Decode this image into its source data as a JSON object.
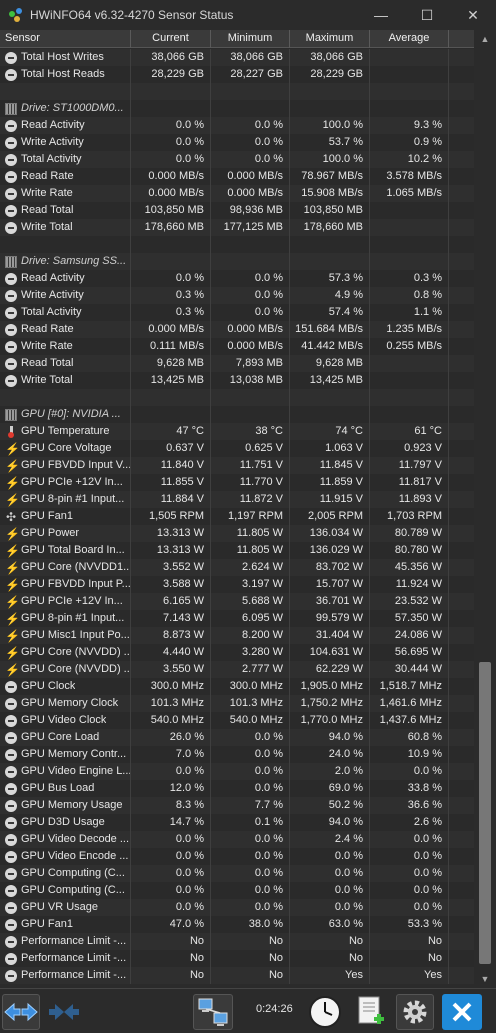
{
  "window": {
    "title": "HWiNFO64 v6.32-4270 Sensor Status",
    "minimize_glyph": "—",
    "maximize_glyph": "☐",
    "close_glyph": "✕"
  },
  "table": {
    "columns": [
      "Sensor",
      "Current",
      "Minimum",
      "Maximum",
      "Average"
    ],
    "rows": [
      {
        "icon": "circle",
        "name": "Total Host Writes",
        "current": "38,066 GB",
        "minimum": "38,066 GB",
        "maximum": "38,066 GB",
        "average": ""
      },
      {
        "icon": "circle",
        "name": "Total Host Reads",
        "current": "28,229 GB",
        "minimum": "28,227 GB",
        "maximum": "28,229 GB",
        "average": ""
      },
      {
        "blank": true
      },
      {
        "icon": "chip",
        "group": true,
        "name": "Drive: ST1000DM0..."
      },
      {
        "icon": "circle",
        "name": "Read Activity",
        "current": "0.0 %",
        "minimum": "0.0 %",
        "maximum": "100.0 %",
        "average": "9.3 %"
      },
      {
        "icon": "circle",
        "name": "Write Activity",
        "current": "0.0 %",
        "minimum": "0.0 %",
        "maximum": "53.7 %",
        "average": "0.9 %"
      },
      {
        "icon": "circle",
        "name": "Total Activity",
        "current": "0.0 %",
        "minimum": "0.0 %",
        "maximum": "100.0 %",
        "average": "10.2 %"
      },
      {
        "icon": "circle",
        "name": "Read Rate",
        "current": "0.000 MB/s",
        "minimum": "0.000 MB/s",
        "maximum": "78.967 MB/s",
        "average": "3.578 MB/s"
      },
      {
        "icon": "circle",
        "name": "Write Rate",
        "current": "0.000 MB/s",
        "minimum": "0.000 MB/s",
        "maximum": "15.908 MB/s",
        "average": "1.065 MB/s"
      },
      {
        "icon": "circle",
        "name": "Read Total",
        "current": "103,850 MB",
        "minimum": "98,936 MB",
        "maximum": "103,850 MB",
        "average": ""
      },
      {
        "icon": "circle",
        "name": "Write Total",
        "current": "178,660 MB",
        "minimum": "177,125 MB",
        "maximum": "178,660 MB",
        "average": ""
      },
      {
        "blank": true
      },
      {
        "icon": "chip",
        "group": true,
        "name": "Drive: Samsung SS..."
      },
      {
        "icon": "circle",
        "name": "Read Activity",
        "current": "0.0 %",
        "minimum": "0.0 %",
        "maximum": "57.3 %",
        "average": "0.3 %"
      },
      {
        "icon": "circle",
        "name": "Write Activity",
        "current": "0.3 %",
        "minimum": "0.0 %",
        "maximum": "4.9 %",
        "average": "0.8 %"
      },
      {
        "icon": "circle",
        "name": "Total Activity",
        "current": "0.3 %",
        "minimum": "0.0 %",
        "maximum": "57.4 %",
        "average": "1.1 %"
      },
      {
        "icon": "circle",
        "name": "Read Rate",
        "current": "0.000 MB/s",
        "minimum": "0.000 MB/s",
        "maximum": "151.684 MB/s",
        "average": "1.235 MB/s"
      },
      {
        "icon": "circle",
        "name": "Write Rate",
        "current": "0.111 MB/s",
        "minimum": "0.000 MB/s",
        "maximum": "41.442 MB/s",
        "average": "0.255 MB/s"
      },
      {
        "icon": "circle",
        "name": "Read Total",
        "current": "9,628 MB",
        "minimum": "7,893 MB",
        "maximum": "9,628 MB",
        "average": ""
      },
      {
        "icon": "circle",
        "name": "Write Total",
        "current": "13,425 MB",
        "minimum": "13,038 MB",
        "maximum": "13,425 MB",
        "average": ""
      },
      {
        "blank": true
      },
      {
        "icon": "chip",
        "group": true,
        "name": "GPU [#0]: NVIDIA ..."
      },
      {
        "icon": "therm",
        "name": "GPU Temperature",
        "current": "47 °C",
        "minimum": "38 °C",
        "maximum": "74 °C",
        "average": "61 °C"
      },
      {
        "icon": "bolt",
        "name": "GPU Core Voltage",
        "current": "0.637 V",
        "minimum": "0.625 V",
        "maximum": "1.063 V",
        "average": "0.923 V"
      },
      {
        "icon": "bolt",
        "name": "GPU FBVDD Input V...",
        "current": "11.840 V",
        "minimum": "11.751 V",
        "maximum": "11.845 V",
        "average": "11.797 V"
      },
      {
        "icon": "bolt",
        "name": "GPU PCIe +12V In...",
        "current": "11.855 V",
        "minimum": "11.770 V",
        "maximum": "11.859 V",
        "average": "11.817 V"
      },
      {
        "icon": "bolt",
        "name": "GPU 8-pin #1 Input...",
        "current": "11.884 V",
        "minimum": "11.872 V",
        "maximum": "11.915 V",
        "average": "11.893 V"
      },
      {
        "icon": "fan",
        "name": "GPU Fan1",
        "current": "1,505 RPM",
        "minimum": "1,197 RPM",
        "maximum": "2,005 RPM",
        "average": "1,703 RPM"
      },
      {
        "icon": "bolt",
        "name": "GPU Power",
        "current": "13.313 W",
        "minimum": "11.805 W",
        "maximum": "136.034 W",
        "average": "80.789 W"
      },
      {
        "icon": "bolt",
        "name": "GPU Total Board In...",
        "current": "13.313 W",
        "minimum": "11.805 W",
        "maximum": "136.029 W",
        "average": "80.780 W"
      },
      {
        "icon": "bolt",
        "name": "GPU Core (NVVDD1...",
        "current": "3.552 W",
        "minimum": "2.624 W",
        "maximum": "83.702 W",
        "average": "45.356 W"
      },
      {
        "icon": "bolt",
        "name": "GPU FBVDD Input P...",
        "current": "3.588 W",
        "minimum": "3.197 W",
        "maximum": "15.707 W",
        "average": "11.924 W"
      },
      {
        "icon": "bolt",
        "name": "GPU PCIe +12V In...",
        "current": "6.165 W",
        "minimum": "5.688 W",
        "maximum": "36.701 W",
        "average": "23.532 W"
      },
      {
        "icon": "bolt",
        "name": "GPU 8-pin #1 Input...",
        "current": "7.143 W",
        "minimum": "6.095 W",
        "maximum": "99.579 W",
        "average": "57.350 W"
      },
      {
        "icon": "bolt",
        "name": "GPU Misc1 Input Po...",
        "current": "8.873 W",
        "minimum": "8.200 W",
        "maximum": "31.404 W",
        "average": "24.086 W"
      },
      {
        "icon": "bolt",
        "name": "GPU Core (NVVDD) ...",
        "current": "4.440 W",
        "minimum": "3.280 W",
        "maximum": "104.631 W",
        "average": "56.695 W"
      },
      {
        "icon": "bolt",
        "name": "GPU Core (NVVDD) ...",
        "current": "3.550 W",
        "minimum": "2.777 W",
        "maximum": "62.229 W",
        "average": "30.444 W"
      },
      {
        "icon": "circle",
        "name": "GPU Clock",
        "current": "300.0 MHz",
        "minimum": "300.0 MHz",
        "maximum": "1,905.0 MHz",
        "average": "1,518.7 MHz"
      },
      {
        "icon": "circle",
        "name": "GPU Memory Clock",
        "current": "101.3 MHz",
        "minimum": "101.3 MHz",
        "maximum": "1,750.2 MHz",
        "average": "1,461.6 MHz"
      },
      {
        "icon": "circle",
        "name": "GPU Video Clock",
        "current": "540.0 MHz",
        "minimum": "540.0 MHz",
        "maximum": "1,770.0 MHz",
        "average": "1,437.6 MHz"
      },
      {
        "icon": "circle",
        "name": "GPU Core Load",
        "current": "26.0 %",
        "minimum": "0.0 %",
        "maximum": "94.0 %",
        "average": "60.8 %"
      },
      {
        "icon": "circle",
        "name": "GPU Memory Contr...",
        "current": "7.0 %",
        "minimum": "0.0 %",
        "maximum": "24.0 %",
        "average": "10.9 %"
      },
      {
        "icon": "circle",
        "name": "GPU Video Engine L...",
        "current": "0.0 %",
        "minimum": "0.0 %",
        "maximum": "2.0 %",
        "average": "0.0 %"
      },
      {
        "icon": "circle",
        "name": "GPU Bus Load",
        "current": "12.0 %",
        "minimum": "0.0 %",
        "maximum": "69.0 %",
        "average": "33.8 %"
      },
      {
        "icon": "circle",
        "name": "GPU Memory Usage",
        "current": "8.3 %",
        "minimum": "7.7 %",
        "maximum": "50.2 %",
        "average": "36.6 %"
      },
      {
        "icon": "circle",
        "name": "GPU D3D Usage",
        "current": "14.7 %",
        "minimum": "0.1 %",
        "maximum": "94.0 %",
        "average": "2.6 %"
      },
      {
        "icon": "circle",
        "name": "GPU Video Decode ...",
        "current": "0.0 %",
        "minimum": "0.0 %",
        "maximum": "2.4 %",
        "average": "0.0 %"
      },
      {
        "icon": "circle",
        "name": "GPU Video Encode ...",
        "current": "0.0 %",
        "minimum": "0.0 %",
        "maximum": "0.0 %",
        "average": "0.0 %"
      },
      {
        "icon": "circle",
        "name": "GPU Computing (C...",
        "current": "0.0 %",
        "minimum": "0.0 %",
        "maximum": "0.0 %",
        "average": "0.0 %"
      },
      {
        "icon": "circle",
        "name": "GPU Computing (C...",
        "current": "0.0 %",
        "minimum": "0.0 %",
        "maximum": "0.0 %",
        "average": "0.0 %"
      },
      {
        "icon": "circle",
        "name": "GPU VR Usage",
        "current": "0.0 %",
        "minimum": "0.0 %",
        "maximum": "0.0 %",
        "average": "0.0 %"
      },
      {
        "icon": "circle",
        "name": "GPU Fan1",
        "current": "47.0 %",
        "minimum": "38.0 %",
        "maximum": "63.0 %",
        "average": "53.3 %"
      },
      {
        "icon": "circle",
        "name": "Performance Limit -...",
        "current": "No",
        "minimum": "No",
        "maximum": "No",
        "average": "No"
      },
      {
        "icon": "circle",
        "name": "Performance Limit -...",
        "current": "No",
        "minimum": "No",
        "maximum": "No",
        "average": "No"
      },
      {
        "icon": "circle",
        "name": "Performance Limit -...",
        "current": "No",
        "minimum": "No",
        "maximum": "Yes",
        "average": "Yes"
      }
    ]
  },
  "footer": {
    "elapsed": "0:24:26"
  },
  "colors": {
    "background": "#2b2b2b",
    "close_button_blue": "#1f8ad8",
    "arrow_blue": "#3d8fe0"
  }
}
